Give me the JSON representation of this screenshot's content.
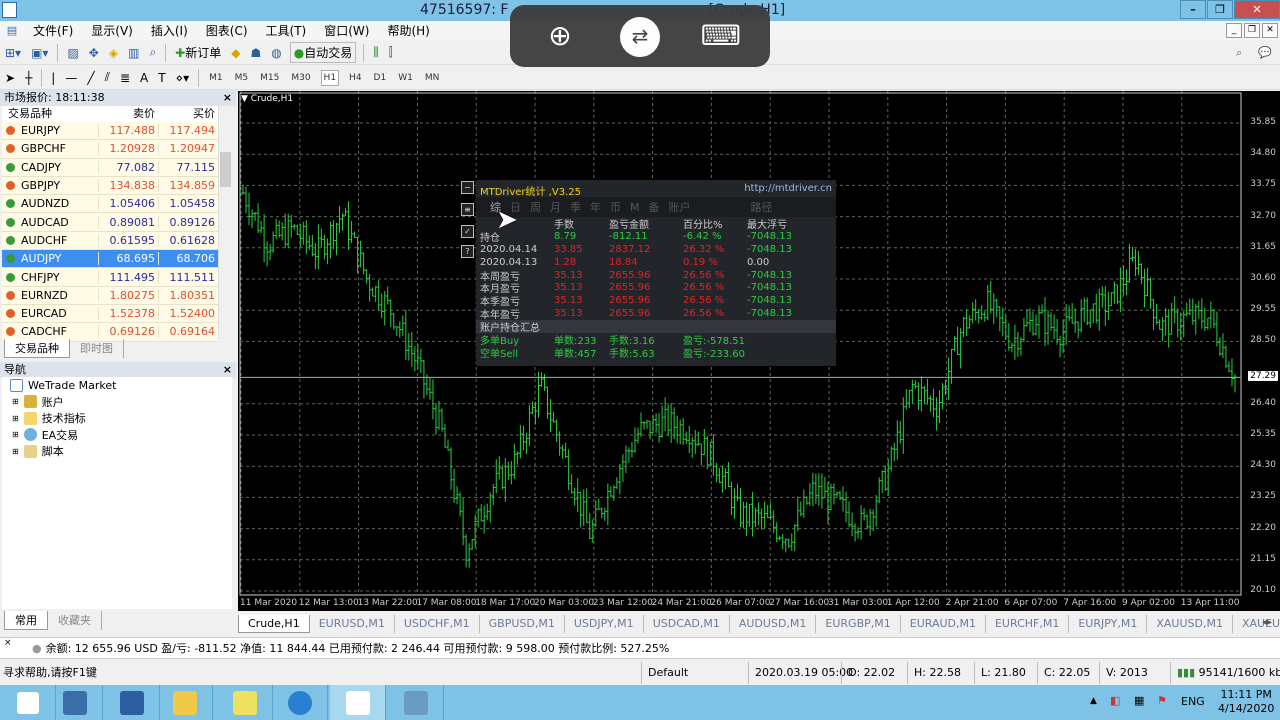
{
  "window": {
    "title": "47516597: F",
    "title_suffix": "[Crude,H1]",
    "min": "–",
    "max": "❐",
    "close": "✕"
  },
  "menu": [
    "文件(F)",
    "显示(V)",
    "插入(I)",
    "图表(C)",
    "工具(T)",
    "窗口(W)",
    "帮助(H)"
  ],
  "toolbar": {
    "new_order": "新订单",
    "auto_trade": "自动交易",
    "timeframes": [
      "M1",
      "M5",
      "M15",
      "M30",
      "H1",
      "H4",
      "D1",
      "W1",
      "MN"
    ],
    "active_tf": "H1"
  },
  "market_watch": {
    "title": "市场报价: 18:11:38",
    "headers": [
      "交易品种",
      "卖价",
      "买价"
    ],
    "rows": [
      {
        "symbol": "EURJPY",
        "bid": "117.488",
        "ask": "117.494",
        "dir": "down"
      },
      {
        "symbol": "GBPCHF",
        "bid": "1.20928",
        "ask": "1.20947",
        "dir": "down"
      },
      {
        "symbol": "CADJPY",
        "bid": "77.082",
        "ask": "77.115",
        "dir": "up"
      },
      {
        "symbol": "GBPJPY",
        "bid": "134.838",
        "ask": "134.859",
        "dir": "down"
      },
      {
        "symbol": "AUDNZD",
        "bid": "1.05406",
        "ask": "1.05458",
        "dir": "up"
      },
      {
        "symbol": "AUDCAD",
        "bid": "0.89081",
        "ask": "0.89126",
        "dir": "up"
      },
      {
        "symbol": "AUDCHF",
        "bid": "0.61595",
        "ask": "0.61628",
        "dir": "up"
      },
      {
        "symbol": "AUDJPY",
        "bid": "68.695",
        "ask": "68.706",
        "dir": "up",
        "selected": true
      },
      {
        "symbol": "CHFJPY",
        "bid": "111.495",
        "ask": "111.511",
        "dir": "up"
      },
      {
        "symbol": "EURNZD",
        "bid": "1.80275",
        "ask": "1.80351",
        "dir": "down"
      },
      {
        "symbol": "EURCAD",
        "bid": "1.52378",
        "ask": "1.52400",
        "dir": "down"
      },
      {
        "symbol": "CADCHF",
        "bid": "0.69126",
        "ask": "0.69164",
        "dir": "down"
      }
    ],
    "tabs": [
      "交易品种",
      "即时图"
    ]
  },
  "navigator": {
    "title": "导航",
    "root": "WeTrade Market",
    "items": [
      "账户",
      "技术指标",
      "EA交易",
      "脚本"
    ],
    "tabs": [
      "常用",
      "收藏夹"
    ]
  },
  "chart": {
    "label": "Crude,H1",
    "current_price": "27.29",
    "price_ticks": [
      "35.85",
      "34.80",
      "33.75",
      "32.70",
      "31.65",
      "30.60",
      "29.55",
      "28.50",
      "26.40",
      "25.35",
      "24.30",
      "23.25",
      "22.20",
      "21.15",
      "20.10"
    ],
    "time_ticks": [
      "11 Mar 2020",
      "12 Mar 13:00",
      "13 Mar 22:00",
      "17 Mar 08:00",
      "18 Mar 17:00",
      "20 Mar 03:00",
      "23 Mar 12:00",
      "24 Mar 21:00",
      "26 Mar 07:00",
      "27 Mar 16:00",
      "31 Mar 03:00",
      "1 Apr 12:00",
      "2 Apr 21:00",
      "6 Apr 07:00",
      "7 Apr 16:00",
      "9 Apr 02:00",
      "13 Apr 11:00"
    ],
    "bar_color": "#2ecc40"
  },
  "chart_data": {
    "type": "ohlc",
    "symbol": "Crude",
    "timeframe": "H1",
    "ylim": [
      20.1,
      35.85
    ],
    "approx_closes": [
      33.5,
      31.8,
      32.3,
      31.5,
      32.8,
      30.6,
      29.5,
      27.8,
      25.5,
      21.5,
      23.5,
      24.5,
      27.0,
      24.5,
      22.0,
      24.0,
      25.5,
      25.8,
      25.5,
      24.5,
      22.7,
      22.5,
      21.9,
      23.5,
      23.0,
      22.3,
      24.1,
      27.0,
      26.3,
      29.0,
      29.8,
      28.5,
      29.3,
      28.8,
      29.5,
      29.8,
      31.3,
      29.0,
      29.3,
      29.3,
      27.29
    ]
  },
  "stats": {
    "title": "MTDriver统计 ,V3.25",
    "url": "http://mtdriver.cn",
    "tabs": [
      "综",
      "日",
      "周",
      "月",
      "季",
      "年",
      "币",
      "M",
      "备",
      "账户",
      "路径"
    ],
    "headers": [
      "手数",
      "盈亏金额",
      "百分比%",
      "最大浮亏"
    ],
    "rows": [
      {
        "label": "持仓",
        "lots": "8.79",
        "pl": "-812.11",
        "pct": "-6.42 %",
        "dd": "-7048.13",
        "c": "g"
      },
      {
        "label": "2020.04.14",
        "lots": "33.85",
        "pl": "2837.12",
        "pct": "26.32 %",
        "dd": "-7048.13",
        "c": "r"
      },
      {
        "label": "2020.04.13",
        "lots": "1.28",
        "pl": "18.84",
        "pct": "0.19 %",
        "dd": "0.00",
        "c": "r"
      },
      {
        "label": "本周盈亏",
        "lots": "35.13",
        "pl": "2655.96",
        "pct": "26.56 %",
        "dd": "-7048.13",
        "c": "r"
      },
      {
        "label": "本月盈亏",
        "lots": "35.13",
        "pl": "2655.96",
        "pct": "26.56 %",
        "dd": "-7048.13",
        "c": "r"
      },
      {
        "label": "本季盈亏",
        "lots": "35.13",
        "pl": "2655.96",
        "pct": "26.56 %",
        "dd": "-7048.13",
        "c": "r"
      },
      {
        "label": "本年盈亏",
        "lots": "35.13",
        "pl": "2655.96",
        "pct": "26.56 %",
        "dd": "-7048.13",
        "c": "r"
      }
    ],
    "summary_title": "账户持仓汇总",
    "buy": {
      "label": "多单Buy",
      "count": "单数:233",
      "lots": "手数:3.16",
      "pl": "盈亏:-578.51"
    },
    "sell": {
      "label": "空单Sell",
      "count": "单数:457",
      "lots": "手数:5.63",
      "pl": "盈亏:-233.60"
    }
  },
  "symbol_tabs": [
    "Crude,H1",
    "EURUSD,M1",
    "USDCHF,M1",
    "GBPUSD,M1",
    "USDJPY,M1",
    "USDCAD,M1",
    "AUDUSD,M1",
    "EURGBP,M1",
    "EURAUD,M1",
    "EURCHF,M1",
    "EURJPY,M1",
    "XAUUSD,M1",
    "XAUEUR,M"
  ],
  "account": "余额: 12 655.96 USD  盈/亏: -811.52  净值: 11 844.44  已用预付款: 2 246.44  可用预付款: 9 598.00  预付款比例: 527.25%",
  "status": {
    "help": "寻求帮助,请按F1键",
    "profile": "Default",
    "time": "2020.03.19 05:00",
    "open": "O: 22.02",
    "high": "H: 22.58",
    "low": "L: 21.80",
    "close": "C: 22.05",
    "volume": "V: 2013",
    "traffic": "95141/1600 kb"
  },
  "tray": {
    "lang": "ENG",
    "time": "11:11 PM",
    "date": "4/14/2020"
  }
}
